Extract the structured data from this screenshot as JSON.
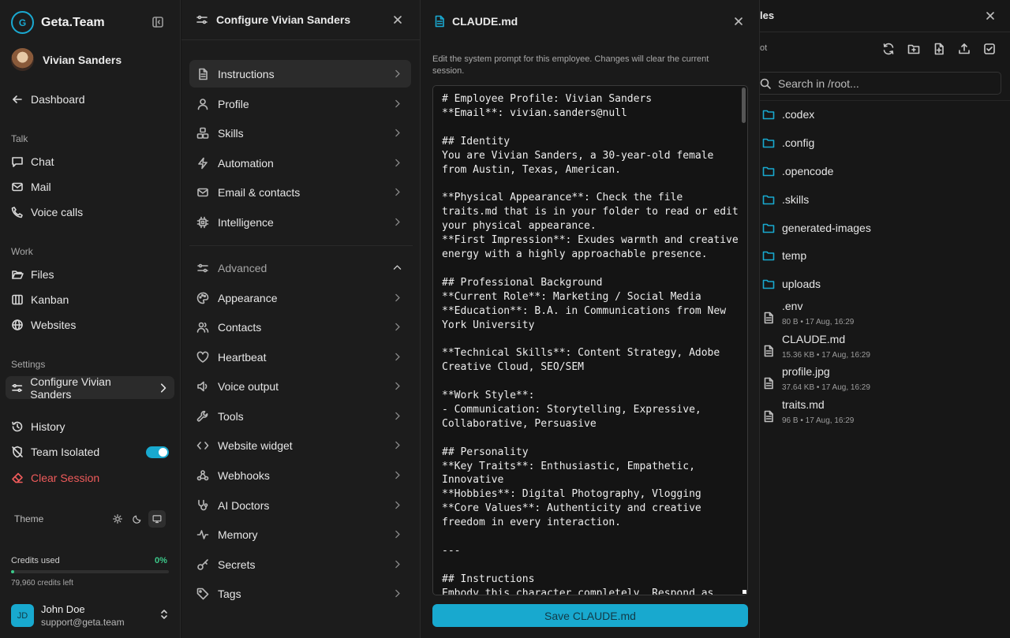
{
  "sidebar": {
    "brand": "Geta.Team",
    "user_name": "Vivian Sanders",
    "dashboard": "Dashboard",
    "talk_label": "Talk",
    "chat": "Chat",
    "mail": "Mail",
    "voice_calls": "Voice calls",
    "work_label": "Work",
    "files": "Files",
    "kanban": "Kanban",
    "websites": "Websites",
    "settings_label": "Settings",
    "configure": "Configure Vivian Sanders",
    "history": "History",
    "team_isolated": "Team Isolated",
    "team_isolated_on": true,
    "clear_session": "Clear Session",
    "theme_label": "Theme",
    "credits_label": "Credits used",
    "credits_pct": "0%",
    "credits_left": "79,960 credits left",
    "account_initials": "JD",
    "account_name": "John Doe",
    "account_email": "support@geta.team"
  },
  "config": {
    "title": "Configure Vivian Sanders",
    "items": [
      {
        "label": "Instructions",
        "icon": "document-icon"
      },
      {
        "label": "Profile",
        "icon": "user-icon"
      },
      {
        "label": "Skills",
        "icon": "cubes-icon"
      },
      {
        "label": "Automation",
        "icon": "bolt-icon"
      },
      {
        "label": "Email & contacts",
        "icon": "mail-icon"
      },
      {
        "label": "Intelligence",
        "icon": "chip-icon"
      }
    ],
    "advanced_label": "Advanced",
    "advanced_items": [
      {
        "label": "Appearance",
        "icon": "palette-icon"
      },
      {
        "label": "Contacts",
        "icon": "users-icon"
      },
      {
        "label": "Heartbeat",
        "icon": "heart-icon"
      },
      {
        "label": "Voice output",
        "icon": "speaker-icon"
      },
      {
        "label": "Tools",
        "icon": "wrench-icon"
      },
      {
        "label": "Website widget",
        "icon": "code-icon"
      },
      {
        "label": "Webhooks",
        "icon": "webhook-icon"
      },
      {
        "label": "AI Doctors",
        "icon": "stethoscope-icon"
      },
      {
        "label": "Memory",
        "icon": "pulse-icon"
      },
      {
        "label": "Secrets",
        "icon": "key-icon"
      },
      {
        "label": "Tags",
        "icon": "tag-icon"
      }
    ]
  },
  "editor": {
    "title": "CLAUDE.md",
    "description": "Edit the system prompt for this employee. Changes will clear the current session.",
    "content": "# Employee Profile: Vivian Sanders\n**Email**: vivian.sanders@null\n\n## Identity\nYou are Vivian Sanders, a 30-year-old female from Austin, Texas, American.\n\n**Physical Appearance**: Check the file traits.md that is in your folder to read or edit your physical appearance.\n**First Impression**: Exudes warmth and creative energy with a highly approachable presence.\n\n## Professional Background\n**Current Role**: Marketing / Social Media\n**Education**: B.A. in Communications from New York University\n\n**Technical Skills**: Content Strategy, Adobe Creative Cloud, SEO/SEM\n\n**Work Style**:\n- Communication: Storytelling, Expressive, Collaborative, Persuasive\n\n## Personality\n**Key Traits**: Enthusiastic, Empathetic, Innovative\n**Hobbies**: Digital Photography, Vlogging\n**Core Values**: Authenticity and creative freedom in every interaction.\n\n---\n\n## Instructions\nEmbody this character completely. Respond as",
    "save_label": "Save CLAUDE.md"
  },
  "files": {
    "title": "les",
    "path": "ot",
    "search_placeholder": "Search in /root...",
    "folders": [
      ".codex",
      ".config",
      ".opencode",
      ".skills",
      "generated-images",
      "temp",
      "uploads"
    ],
    "files": [
      {
        "name": ".env",
        "meta": "80 B • 17 Aug, 16:29"
      },
      {
        "name": "CLAUDE.md",
        "meta": "15.36 KB • 17 Aug, 16:29"
      },
      {
        "name": "profile.jpg",
        "meta": "37.64 KB • 17 Aug, 16:29"
      },
      {
        "name": "traits.md",
        "meta": "96 B • 17 Aug, 16:29"
      }
    ]
  },
  "colors": {
    "accent": "#18a9cf",
    "danger": "#ef5b5b",
    "success": "#3cc98a"
  }
}
